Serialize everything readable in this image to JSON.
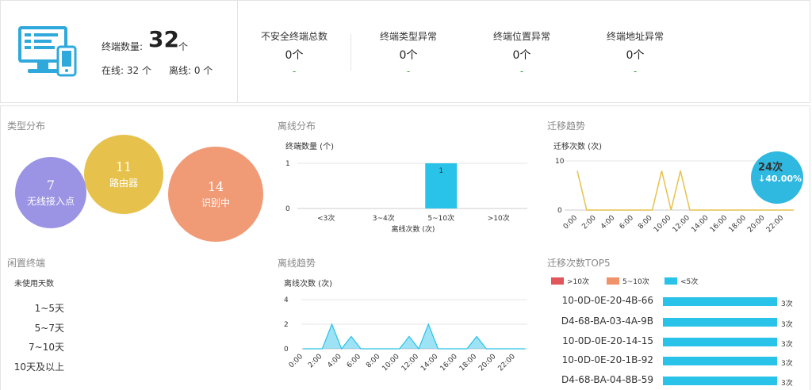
{
  "summary": {
    "total_label": "终端数量:",
    "total_value": "32",
    "total_unit": "个",
    "online": "在线: 32 个",
    "offline": "离线: 0 个"
  },
  "stats": [
    {
      "title": "不安全终端总数",
      "value": "0个",
      "delta": "-"
    },
    {
      "title": "终端类型异常",
      "value": "0个",
      "delta": "-"
    },
    {
      "title": "终端位置异常",
      "value": "0个",
      "delta": "-"
    },
    {
      "title": "终端地址异常",
      "value": "0个",
      "delta": "-"
    }
  ],
  "type_dist": {
    "title": "类型分布",
    "bubbles": [
      {
        "value": "7",
        "label": "无线接入点",
        "color": "#9b93e4"
      },
      {
        "value": "11",
        "label": "路由器",
        "color": "#e6c24c"
      },
      {
        "value": "14",
        "label": "识别中",
        "color": "#f19a76"
      }
    ]
  },
  "offline_dist": {
    "title": "离线分布",
    "ylabel": "终端数量 (个)",
    "xlabel": "离线次数 (次)",
    "yticks": [
      "1",
      "0"
    ],
    "categories": [
      "<3次",
      "3~4次",
      "5~10次",
      ">10次"
    ],
    "values": [
      0,
      0,
      1,
      0
    ],
    "bar_label": "1",
    "color": "#29c2e8"
  },
  "migration_trend": {
    "title": "迁移趋势",
    "ylabel": "迁移次数 (次)",
    "yticks": [
      "10",
      "0"
    ],
    "xticks": [
      "0:00",
      "2:00",
      "4:00",
      "6:00",
      "8:00",
      "10:00",
      "12:00",
      "14:00",
      "16:00",
      "18:00",
      "20:00",
      "22:00"
    ],
    "color": "#e6c24c",
    "badge_value": "24次",
    "badge_change": "↓40.00%",
    "badge_color": "#2fb8e0"
  },
  "idle": {
    "title": "闲置终端",
    "sublabel": "未使用天数",
    "rows": [
      "1~5天",
      "5~7天",
      "7~10天",
      "10天及以上"
    ]
  },
  "offline_trend": {
    "title": "离线趋势",
    "ylabel": "离线次数 (次)",
    "yticks": [
      "4",
      "2",
      "0"
    ],
    "xticks": [
      "0:00",
      "2:00",
      "4:00",
      "6:00",
      "8:00",
      "10:00",
      "12:00",
      "14:00",
      "16:00",
      "18:00",
      "20:00",
      "22:00"
    ],
    "color": "#29c2e8"
  },
  "top5": {
    "title": "迁移次数TOP5",
    "legend": [
      {
        "label": ">10次",
        "color": "#e0565b"
      },
      {
        "label": "5~10次",
        "color": "#f0926a"
      },
      {
        "label": "<5次",
        "color": "#29c2e8"
      }
    ],
    "items": [
      {
        "name": "10-0D-0E-20-4B-66",
        "value": 3,
        "label": "3次"
      },
      {
        "name": "D4-68-BA-03-4A-9B",
        "value": 3,
        "label": "3次"
      },
      {
        "name": "10-0D-0E-20-14-15",
        "value": 3,
        "label": "3次"
      },
      {
        "name": "10-0D-0E-20-1B-92",
        "value": 3,
        "label": "3次"
      },
      {
        "name": "D4-68-BA-04-8B-59",
        "value": 3,
        "label": "3次"
      }
    ]
  },
  "chart_data": [
    {
      "type": "bar",
      "ylabel": "终端数量 (个)",
      "xlabel": "离线次数 (次)",
      "categories": [
        "<3次",
        "3~4次",
        "5~10次",
        ">10次"
      ],
      "values": [
        0,
        0,
        1,
        0
      ],
      "ylim": [
        0,
        1
      ]
    },
    {
      "type": "line",
      "ylabel": "迁移次数 (次)",
      "x": [
        "0:00",
        "1:00",
        "2:00",
        "3:00",
        "4:00",
        "5:00",
        "6:00",
        "7:00",
        "8:00",
        "9:00",
        "10:00",
        "11:00",
        "12:00",
        "13:00",
        "14:00",
        "15:00",
        "16:00",
        "17:00",
        "18:00",
        "19:00",
        "20:00",
        "21:00",
        "22:00",
        "23:00"
      ],
      "values": [
        8,
        0,
        0,
        0,
        0,
        0,
        0,
        0,
        0,
        8,
        0,
        8,
        0,
        0,
        0,
        0,
        0,
        0,
        0,
        0,
        0,
        0,
        0,
        0
      ],
      "ylim": [
        0,
        10
      ]
    },
    {
      "type": "area",
      "ylabel": "离线次数 (次)",
      "x": [
        "0:00",
        "1:00",
        "2:00",
        "3:00",
        "4:00",
        "5:00",
        "6:00",
        "7:00",
        "8:00",
        "9:00",
        "10:00",
        "11:00",
        "12:00",
        "13:00",
        "14:00",
        "15:00",
        "16:00",
        "17:00",
        "18:00",
        "19:00",
        "20:00",
        "21:00",
        "22:00",
        "23:00"
      ],
      "values": [
        0,
        0,
        0,
        2,
        0,
        1,
        0,
        0,
        0,
        0,
        0,
        1,
        0,
        2,
        0,
        0,
        0,
        0,
        1,
        0,
        0,
        0,
        0,
        0
      ],
      "ylim": [
        0,
        4
      ]
    },
    {
      "type": "bar",
      "categories": [
        "10-0D-0E-20-4B-66",
        "D4-68-BA-03-4A-9B",
        "10-0D-0E-20-14-15",
        "10-0D-0E-20-1B-92",
        "D4-68-BA-04-8B-59"
      ],
      "values": [
        3,
        3,
        3,
        3,
        3
      ]
    }
  ]
}
